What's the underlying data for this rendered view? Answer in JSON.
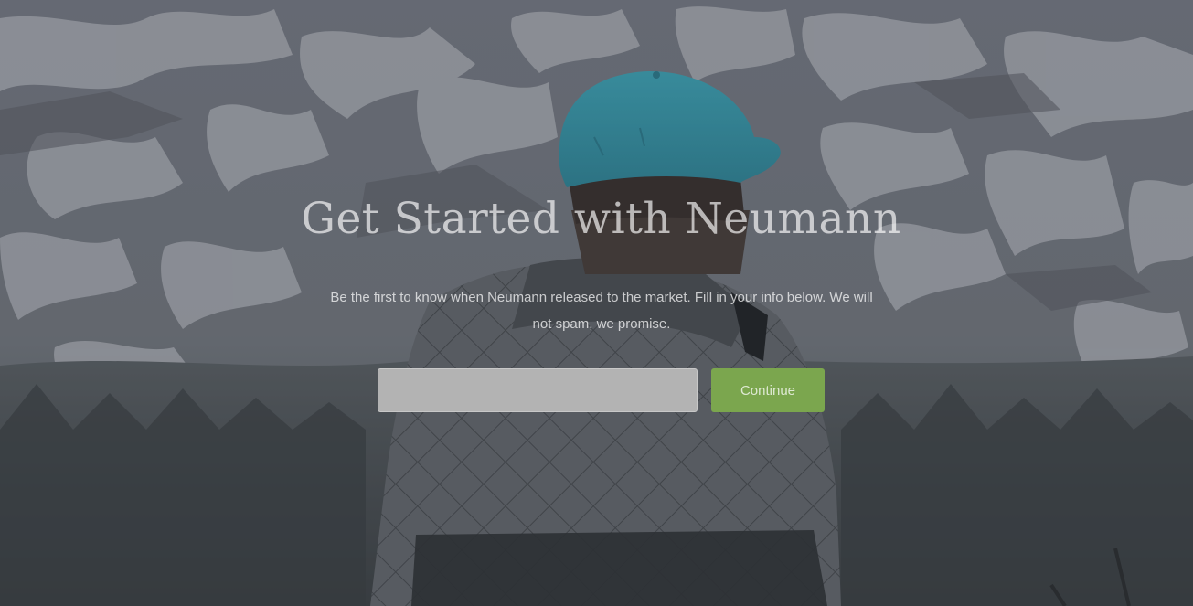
{
  "hero": {
    "headline": "Get Started with Neumann",
    "subtitle": "Be the first to know when Neumann released to the market. Fill in your info below. We will not spam, we promise."
  },
  "signup": {
    "email_value": "",
    "email_placeholder": "",
    "continue_label": "Continue"
  },
  "colors": {
    "button_green": "#7ba64e",
    "input_gray": "#b3b3b3",
    "cap_teal": "#3aa3b8"
  }
}
